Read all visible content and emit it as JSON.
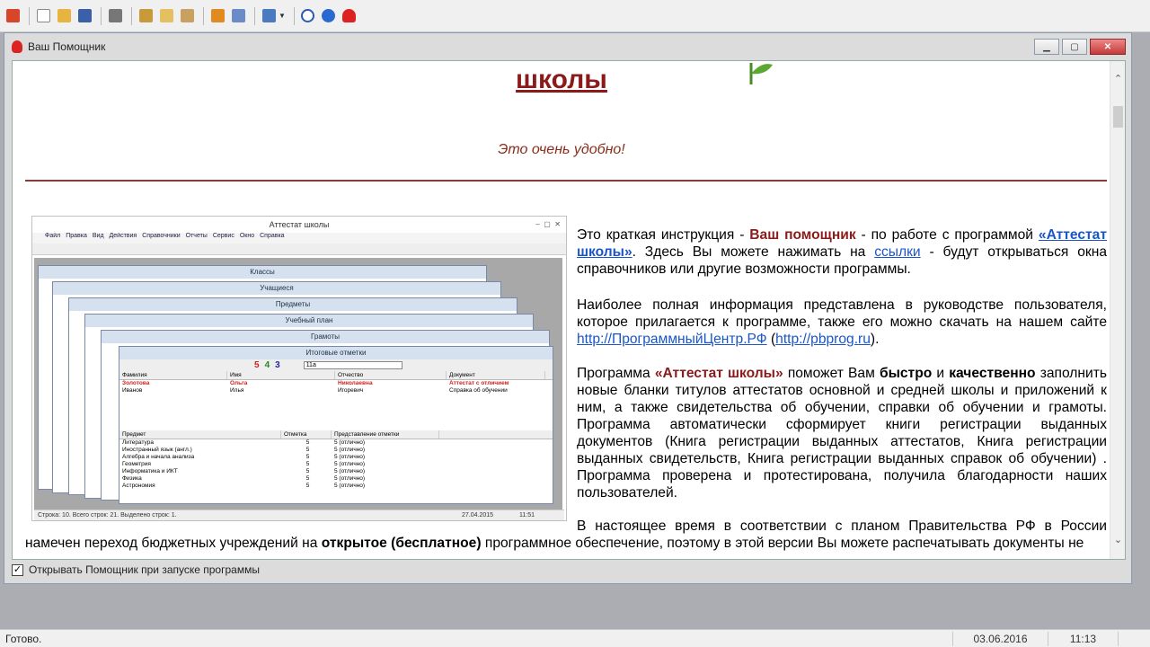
{
  "window": {
    "title": "Ваш Помощник"
  },
  "content": {
    "heading": "школы",
    "subtitle": "Это очень удобно!",
    "p1": {
      "a": "Это краткая инструкция - ",
      "b": "Ваш помощник",
      "c": " - по работе с программой ",
      "d": "«Аттестат школы»",
      "e": ". Здесь Вы можете нажимать на ",
      "f": "ссылки",
      "g": " - будут открываться окна справочников или другие возможности программы."
    },
    "p2": {
      "a": "Наиболее полная информация представлена в руководстве пользователя, которое прилагается к программе, также его можно скачать на нашем сайте ",
      "b": "http://ПрограммныйЦентр.РФ",
      "c": " (",
      "d": "http://pbprog.ru",
      "e": ")."
    },
    "p3": {
      "a": "Программа ",
      "b": "«Аттестат школы»",
      "c": " поможет Вам ",
      "d": "быстро",
      "e": " и ",
      "f": "качественно",
      "g": " заполнить новые бланки титулов аттестатов основной и средней школы и приложений к ним, а также свидетельства об обучении, справки об обучении и грамоты. Программа автоматически сформирует книги регистрации выданных документов (Книга регистрации выданных аттестатов, Книга регистрации выданных свидетельств, Книга регистрации выданных справок об обучении) . Программа проверена и протестирована, получила благодарности наших пользователей."
    },
    "p4": {
      "a": "В настоящее время в соответствии с планом Правительства РФ в России намечен переход бюджетных учреждений на ",
      "b": "открытое (бесплатное)",
      "c": " программное обеспечение, поэтому в этой версии Вы можете распечатывать документы не"
    }
  },
  "checkbox": {
    "label": "Открывать Помощник при запуске программы",
    "checked": true
  },
  "status": {
    "text": "Готово.",
    "date": "03.06.2016",
    "time": "11:13"
  },
  "screenshot": {
    "title": "Аттестат школы",
    "menu": [
      "Файл",
      "Правка",
      "Вид",
      "Действия",
      "Справочники",
      "Отчеты",
      "Сервис",
      "Окно",
      "Справка"
    ],
    "windows": [
      "Классы",
      "Учащиеся",
      "Предметы",
      "Учебный план",
      "Грамоты",
      "Итоговые отметки"
    ],
    "grades": [
      "5",
      "4",
      "3"
    ],
    "combo": "11а",
    "students_header": [
      "Фамилия",
      "Имя",
      "Отчество",
      "Документ"
    ],
    "students": [
      [
        "Золотова",
        "Ольга",
        "Николаевна",
        "Аттестат с отличием"
      ],
      [
        "Иванов",
        "Илья",
        "Игоревич",
        "Справка об обучении"
      ]
    ],
    "subjects_header": [
      "Предмет",
      "Отметка",
      "Представление отметки"
    ],
    "subjects": [
      [
        "Литература",
        "5",
        "5 (отлично)"
      ],
      [
        "Иностранный язык (англ.)",
        "5",
        "5 (отлично)"
      ],
      [
        "Алгебра и начала анализа",
        "5",
        "5 (отлично)"
      ],
      [
        "Геометрия",
        "5",
        "5 (отлично)"
      ],
      [
        "Информатика и ИКТ",
        "5",
        "5 (отлично)"
      ],
      [
        "Физика",
        "5",
        "5 (отлично)"
      ],
      [
        "Астрономия",
        "5",
        "5 (отлично)"
      ]
    ],
    "status_text": "Строка: 10. Всего строк: 21. Выделено строк: 1.",
    "status_date": "27.04.2015",
    "status_time": "11:51"
  }
}
